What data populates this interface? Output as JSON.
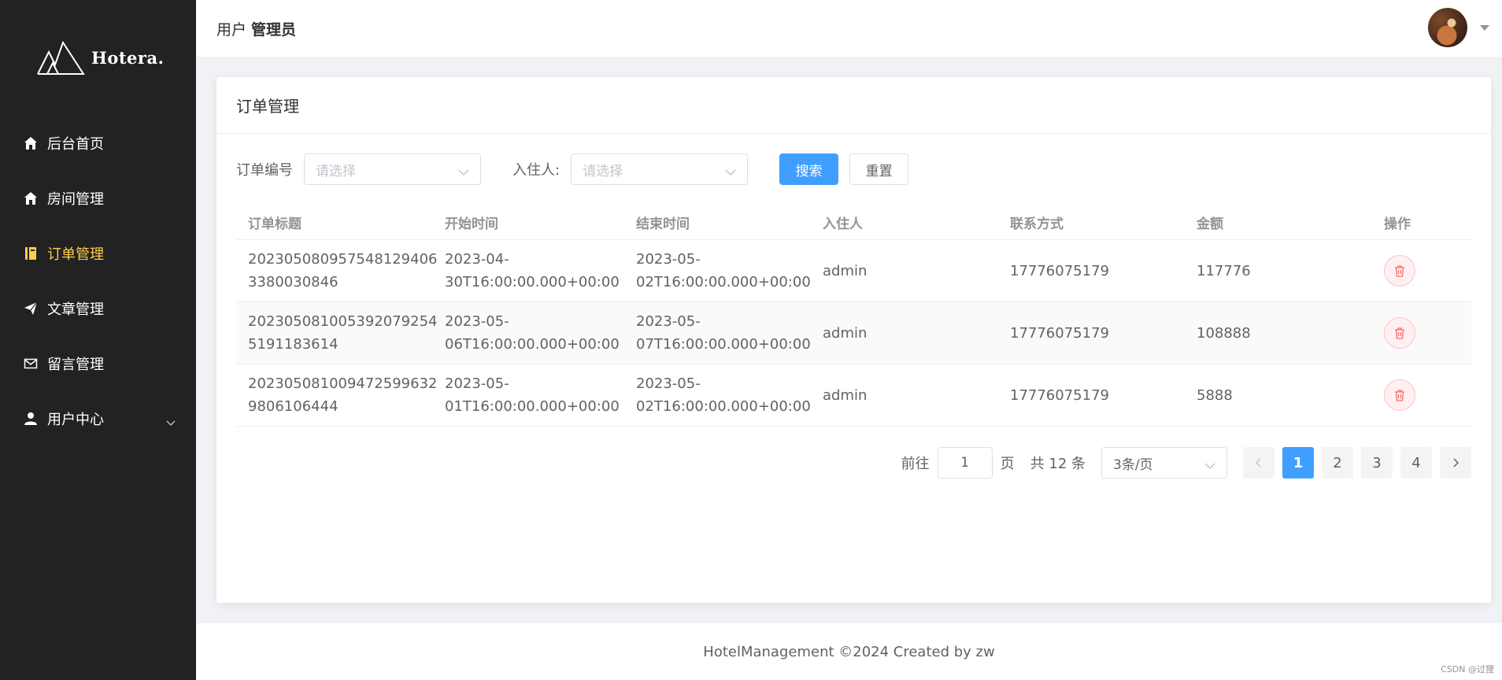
{
  "brand": {
    "name": "Hotera."
  },
  "sidebar": {
    "items": [
      {
        "label": "后台首页",
        "icon": "home-icon"
      },
      {
        "label": "房间管理",
        "icon": "home-icon"
      },
      {
        "label": "订单管理",
        "icon": "notebook-icon",
        "active": true
      },
      {
        "label": "文章管理",
        "icon": "send-icon"
      },
      {
        "label": "留言管理",
        "icon": "mail-icon"
      },
      {
        "label": "用户中心",
        "icon": "user-icon",
        "expandable": true
      }
    ]
  },
  "header": {
    "role_prefix": "用户",
    "role_name": "管理员"
  },
  "card": {
    "title": "订单管理"
  },
  "filters": {
    "order_no_label": "订单编号",
    "order_no_placeholder": "请选择",
    "guest_label": "入住人:",
    "guest_placeholder": "请选择",
    "search_label": "搜索",
    "reset_label": "重置"
  },
  "table": {
    "columns": [
      "订单标题",
      "开始时间",
      "结束时间",
      "入住人",
      "联系方式",
      "金额",
      "操作"
    ],
    "rows": [
      {
        "title_1": "202305080957548129406",
        "title_2": "3380030846",
        "start_1": "2023-04-",
        "start_2": "30T16:00:00.000+00:00",
        "end_1": "2023-05-",
        "end_2": "02T16:00:00.000+00:00",
        "guest": "admin",
        "phone": "17776075179",
        "amount": "117776"
      },
      {
        "title_1": "202305081005392079254",
        "title_2": "5191183614",
        "start_1": "2023-05-",
        "start_2": "06T16:00:00.000+00:00",
        "end_1": "2023-05-",
        "end_2": "07T16:00:00.000+00:00",
        "guest": "admin",
        "phone": "17776075179",
        "amount": "108888"
      },
      {
        "title_1": "202305081009472599632",
        "title_2": "9806106444",
        "start_1": "2023-05-",
        "start_2": "01T16:00:00.000+00:00",
        "end_1": "2023-05-",
        "end_2": "02T16:00:00.000+00:00",
        "guest": "admin",
        "phone": "17776075179",
        "amount": "5888"
      }
    ]
  },
  "pagination": {
    "goto_label": "前往",
    "goto_value": "1",
    "page_unit": "页",
    "total_text": "共 12 条",
    "page_size": "3条/页",
    "pages": [
      "1",
      "2",
      "3",
      "4"
    ],
    "current": "1"
  },
  "footer": {
    "text": "HotelManagement ©2024 Created by zw"
  },
  "watermark": "CSDN @过狸",
  "colors": {
    "sidebar_bg": "#222222",
    "active": "#ffd04b",
    "primary": "#409eff",
    "danger": "#f56c6c"
  }
}
